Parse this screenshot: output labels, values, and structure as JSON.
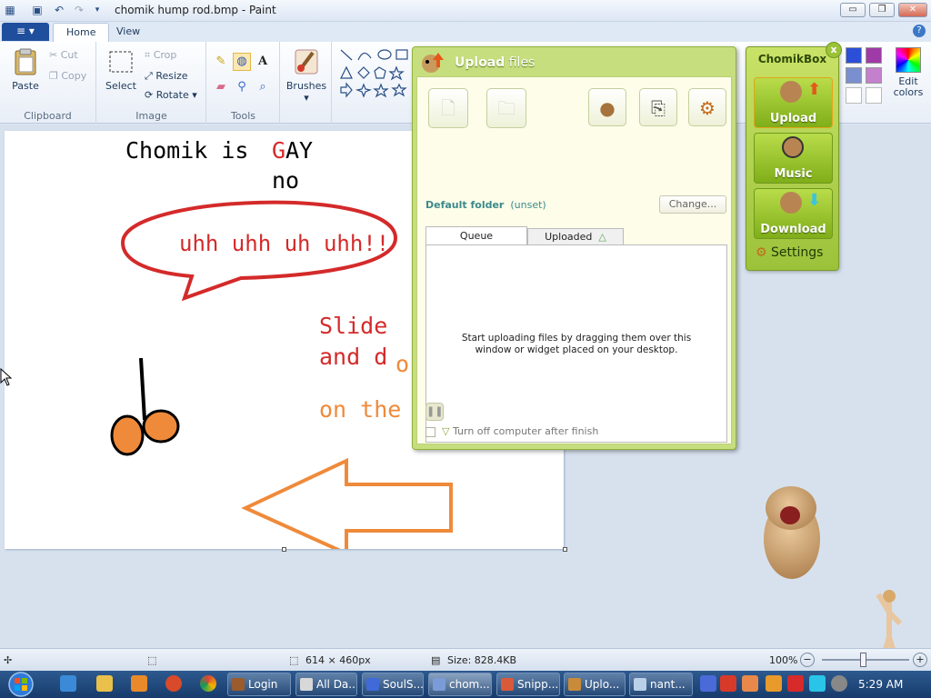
{
  "window": {
    "title": "chomik hump rod.bmp - Paint",
    "controls": {
      "minimize": "▭",
      "restore": "❐",
      "close": "✕"
    }
  },
  "ribbon": {
    "file_menu": "≡ ▾",
    "tabs": [
      {
        "label": "Home",
        "active": true
      },
      {
        "label": "View",
        "active": false
      }
    ],
    "clipboard": {
      "paste": "Paste",
      "cut": "Cut",
      "copy": "Copy",
      "label": "Clipboard"
    },
    "image": {
      "select": "Select",
      "crop": "Crop",
      "resize": "Resize",
      "rotate": "Rotate",
      "label": "Image"
    },
    "tools": {
      "label": "Tools"
    },
    "brushes": "Brushes",
    "edit_colors": "Edit colors",
    "colors": {
      "accent": "#1f4f9c",
      "palette": [
        "#2b4fd6",
        "#9f3aa6",
        "#7a8fd0",
        "#c480cc",
        "#ffffff",
        "#ffffff"
      ]
    }
  },
  "canvas": {
    "texts": [
      {
        "text": "Chomik is",
        "color": "#000000"
      },
      {
        "text": "G",
        "color": "#d42a2a"
      },
      {
        "text": "AY",
        "color": "#000000"
      },
      {
        "text": "no",
        "color": "#000000"
      },
      {
        "text": "uhh uhh uh uhh!!",
        "color": "#d42a2a"
      },
      {
        "text": "Slide",
        "color": "#d42a2a"
      },
      {
        "text": "and d",
        "color": "#d42a2a"
      },
      {
        "text": "o",
        "color": "#ef8a3a"
      },
      {
        "text": "on the",
        "color": "#ef8a3a"
      }
    ],
    "colors": {
      "bubble": "#d42a2a",
      "arrow": "#ef8a3a",
      "balls": "#ef8a3a"
    }
  },
  "status": {
    "dimensions": "614 × 460px",
    "size": "Size: 828.4KB",
    "zoom": "100%"
  },
  "upload": {
    "title_bold": "Upload",
    "title_rest": " files",
    "default_folder_label": "Default folder",
    "default_folder_value": "(unset)",
    "change_button": "Change...",
    "tabs": [
      {
        "label": "Queue",
        "active": true
      },
      {
        "label": "Uploaded",
        "active": false
      }
    ],
    "empty_message": "Start uploading files by dragging them over this window or widget placed on your desktop.",
    "turn_off_label": "Turn off computer after finish",
    "colors": {
      "frame": "#c7de7e",
      "link": "#3b8a8a"
    }
  },
  "chomikbox": {
    "title": "ChomikBox",
    "buttons": [
      {
        "label": "Upload"
      },
      {
        "label": "Music"
      },
      {
        "label": "Download"
      }
    ],
    "settings": "Settings",
    "close": "x"
  },
  "taskbar": {
    "buttons": [
      {
        "label": "Login",
        "color": "#9a5c2c"
      },
      {
        "label": "All Da...",
        "color": "#d8d8d8"
      },
      {
        "label": "SoulS...",
        "color": "#3f6ad8"
      },
      {
        "label": "chom...",
        "color": "#7b9bd8"
      },
      {
        "label": "Snipp...",
        "color": "#d85a3a"
      },
      {
        "label": "Uplo...",
        "color": "#c98b3a"
      },
      {
        "label": "nant...",
        "color": "#b8d0e8"
      }
    ],
    "clock": "5:29 AM"
  }
}
